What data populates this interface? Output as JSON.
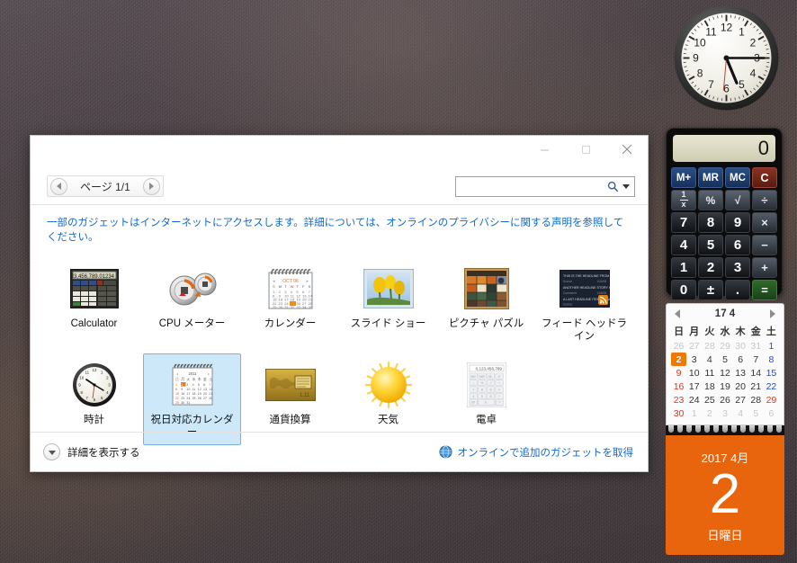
{
  "window": {
    "minimize_icon": "minimize-icon",
    "maximize_icon": "maximize-icon",
    "close_icon": "close-icon",
    "pager_label": "ページ 1/1",
    "search_value": "",
    "search_placeholder": "",
    "search_icon": "search-icon",
    "notice": "一部のガジェットはインターネットにアクセスします。詳細については、オンラインのプライバシーに関する声明を参照してください。",
    "footer": {
      "details_label": "詳細を表示する",
      "online_label": "オンラインで追加のガジェットを取得"
    }
  },
  "gadgets": [
    {
      "label": "Calculator",
      "icon": "calculator-gadget-icon",
      "selected": false
    },
    {
      "label": "CPU メーター",
      "icon": "cpu-meter-gadget-icon",
      "selected": false
    },
    {
      "label": "カレンダー",
      "icon": "calendar-gadget-icon",
      "selected": false
    },
    {
      "label": "スライド ショー",
      "icon": "slideshow-gadget-icon",
      "selected": false
    },
    {
      "label": "ピクチャ パズル",
      "icon": "picture-puzzle-gadget-icon",
      "selected": false
    },
    {
      "label": "フィード ヘッドライン",
      "icon": "feed-headlines-gadget-icon",
      "selected": false
    },
    {
      "label": "時計",
      "icon": "clock-gadget-icon",
      "selected": false
    },
    {
      "label": "祝日対応カレンダー",
      "icon": "holiday-calendar-gadget-icon",
      "selected": true
    },
    {
      "label": "通貨換算",
      "icon": "currency-gadget-icon",
      "selected": false
    },
    {
      "label": "天気",
      "icon": "weather-gadget-icon",
      "selected": false
    },
    {
      "label": "電卓",
      "icon": "denaku-calculator-gadget-icon",
      "selected": false
    }
  ],
  "sidebar": {
    "clock": {
      "hour": 5,
      "minute": 15,
      "hour_numerals": [
        "12",
        "1",
        "2",
        "3",
        "4",
        "5",
        "6",
        "7",
        "8",
        "9",
        "10",
        "11"
      ]
    },
    "calculator": {
      "display": "0",
      "rows": [
        [
          {
            "t": "M+",
            "c": "mem"
          },
          {
            "t": "MR",
            "c": "mem"
          },
          {
            "t": "MC",
            "c": "mem"
          },
          {
            "t": "C",
            "c": "clr"
          }
        ],
        [
          {
            "t": "1/x",
            "c": "fn"
          },
          {
            "t": "%",
            "c": "fn"
          },
          {
            "t": "√",
            "c": "fn"
          },
          {
            "t": "÷",
            "c": "op"
          }
        ],
        [
          {
            "t": "7",
            "c": "num"
          },
          {
            "t": "8",
            "c": "num"
          },
          {
            "t": "9",
            "c": "num"
          },
          {
            "t": "×",
            "c": "op"
          }
        ],
        [
          {
            "t": "4",
            "c": "num"
          },
          {
            "t": "5",
            "c": "num"
          },
          {
            "t": "6",
            "c": "num"
          },
          {
            "t": "−",
            "c": "op"
          }
        ],
        [
          {
            "t": "1",
            "c": "num"
          },
          {
            "t": "2",
            "c": "num"
          },
          {
            "t": "3",
            "c": "num"
          },
          {
            "t": "+",
            "c": "op"
          }
        ],
        [
          {
            "t": "0",
            "c": "num"
          },
          {
            "t": "±",
            "c": "num"
          },
          {
            "t": ".",
            "c": "num"
          },
          {
            "t": "=",
            "c": "eq"
          }
        ]
      ]
    },
    "calendar": {
      "nav_title": "17 4",
      "weekdays": [
        "日",
        "月",
        "火",
        "水",
        "木",
        "金",
        "土"
      ],
      "weeks": [
        [
          {
            "d": "26",
            "k": "other"
          },
          {
            "d": "27",
            "k": "other"
          },
          {
            "d": "28",
            "k": "other"
          },
          {
            "d": "29",
            "k": "other"
          },
          {
            "d": "30",
            "k": "other"
          },
          {
            "d": "31",
            "k": "other"
          },
          {
            "d": "1",
            "k": "sat"
          }
        ],
        [
          {
            "d": "2",
            "k": "today"
          },
          {
            "d": "3",
            "k": "day"
          },
          {
            "d": "4",
            "k": "day"
          },
          {
            "d": "5",
            "k": "day"
          },
          {
            "d": "6",
            "k": "day"
          },
          {
            "d": "7",
            "k": "day"
          },
          {
            "d": "8",
            "k": "sat"
          }
        ],
        [
          {
            "d": "9",
            "k": "sun"
          },
          {
            "d": "10",
            "k": "day"
          },
          {
            "d": "11",
            "k": "day"
          },
          {
            "d": "12",
            "k": "day"
          },
          {
            "d": "13",
            "k": "day"
          },
          {
            "d": "14",
            "k": "day"
          },
          {
            "d": "15",
            "k": "sat"
          }
        ],
        [
          {
            "d": "16",
            "k": "sun"
          },
          {
            "d": "17",
            "k": "day"
          },
          {
            "d": "18",
            "k": "day"
          },
          {
            "d": "19",
            "k": "day"
          },
          {
            "d": "20",
            "k": "day"
          },
          {
            "d": "21",
            "k": "day"
          },
          {
            "d": "22",
            "k": "sat"
          }
        ],
        [
          {
            "d": "23",
            "k": "sun"
          },
          {
            "d": "24",
            "k": "day"
          },
          {
            "d": "25",
            "k": "day"
          },
          {
            "d": "26",
            "k": "day"
          },
          {
            "d": "27",
            "k": "day"
          },
          {
            "d": "28",
            "k": "day"
          },
          {
            "d": "29",
            "k": "sun"
          }
        ],
        [
          {
            "d": "30",
            "k": "sun"
          },
          {
            "d": "1",
            "k": "other"
          },
          {
            "d": "2",
            "k": "other"
          },
          {
            "d": "3",
            "k": "other"
          },
          {
            "d": "4",
            "k": "other"
          },
          {
            "d": "5",
            "k": "other"
          },
          {
            "d": "6",
            "k": "other"
          }
        ]
      ],
      "big_year_month": "2017 4月",
      "big_day": "2",
      "big_weekday": "日曜日"
    }
  },
  "colors": {
    "accent_blue": "#1569c7",
    "selection_blue": "#cde8f9",
    "calendar_orange": "#e8650e",
    "today_orange": "#f07800"
  }
}
